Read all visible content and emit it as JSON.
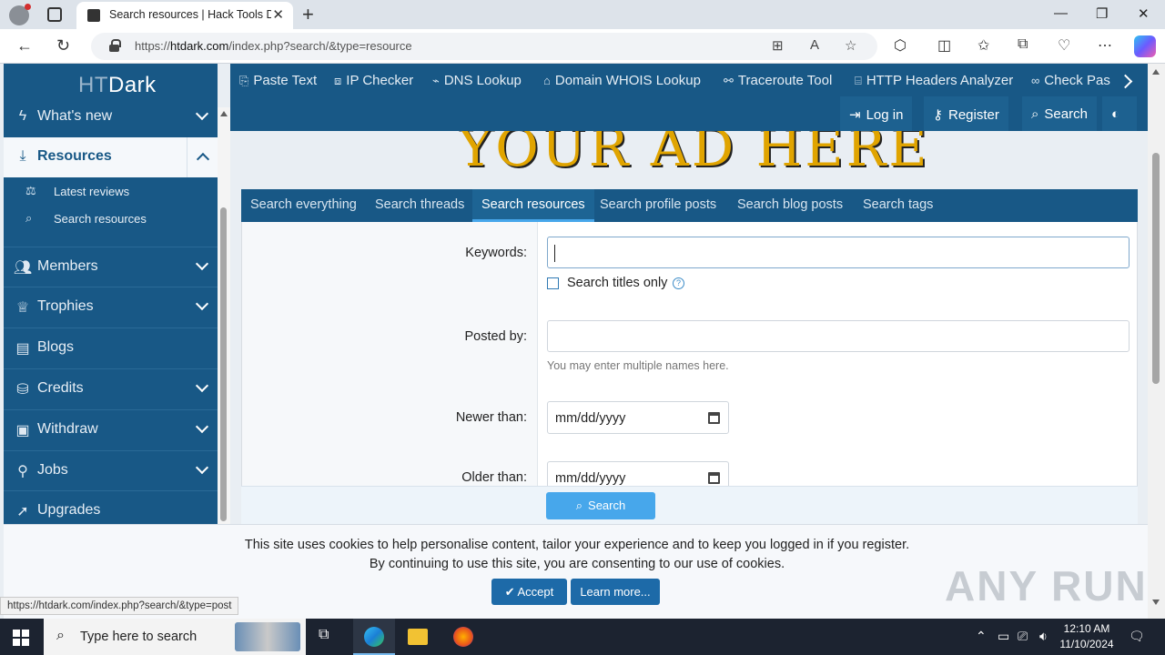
{
  "browser": {
    "tab_title": "Search resources | Hack Tools Dark",
    "url_prefix": "https://",
    "url_domain": "htdark.com",
    "url_path": "/index.php?search/&type=resource"
  },
  "site": {
    "logo_ht": "HT",
    "logo_dark": "Dark"
  },
  "sidebar": {
    "items": [
      {
        "label": "What's new"
      },
      {
        "label": "Resources"
      },
      {
        "label": "Members"
      },
      {
        "label": "Trophies"
      },
      {
        "label": "Blogs"
      },
      {
        "label": "Credits"
      },
      {
        "label": "Withdraw"
      },
      {
        "label": "Jobs"
      },
      {
        "label": "Upgrades"
      }
    ],
    "sub_items": [
      {
        "label": "Latest reviews"
      },
      {
        "label": "Search resources"
      }
    ]
  },
  "topnav": {
    "items": [
      {
        "label": "Paste Text"
      },
      {
        "label": "IP Checker"
      },
      {
        "label": "DNS Lookup"
      },
      {
        "label": "Domain WHOIS Lookup"
      },
      {
        "label": "Traceroute Tool"
      },
      {
        "label": "HTTP Headers Analyzer"
      },
      {
        "label": "Check Pas"
      }
    ],
    "login": "Log in",
    "register": "Register",
    "search": "Search"
  },
  "banner": {
    "text": "YOUR AD HERE"
  },
  "search_tabs": [
    {
      "label": "Search everything"
    },
    {
      "label": "Search threads"
    },
    {
      "label": "Search resources"
    },
    {
      "label": "Search profile posts"
    },
    {
      "label": "Search blog posts"
    },
    {
      "label": "Search tags"
    }
  ],
  "form": {
    "keywords_label": "Keywords:",
    "keywords_value": "",
    "titles_only_label": "Search titles only",
    "posted_by_label": "Posted by:",
    "posted_by_hint": "You may enter multiple names here.",
    "newer_than_label": "Newer than:",
    "newer_than_value": "mm/dd/yyyy",
    "older_than_label": "Older than:",
    "older_than_value": "mm/dd/yyyy",
    "submit_label": "Search"
  },
  "cookie": {
    "line1": "This site uses cookies to help personalise content, tailor your experience and to keep you logged in if you register.",
    "line2": "By continuing to use this site, you are consenting to our use of cookies.",
    "accept": "Accept",
    "learn_more": "Learn more..."
  },
  "status_bar": {
    "url": "https://htdark.com/index.php?search/&type=post"
  },
  "watermark": "ANY RUN",
  "taskbar": {
    "search_placeholder": "Type here to search",
    "time": "12:10 AM",
    "date": "11/10/2024"
  },
  "colors": {
    "primary": "#185886",
    "accent": "#47a7eb",
    "banner_gold": "#e0a400"
  }
}
